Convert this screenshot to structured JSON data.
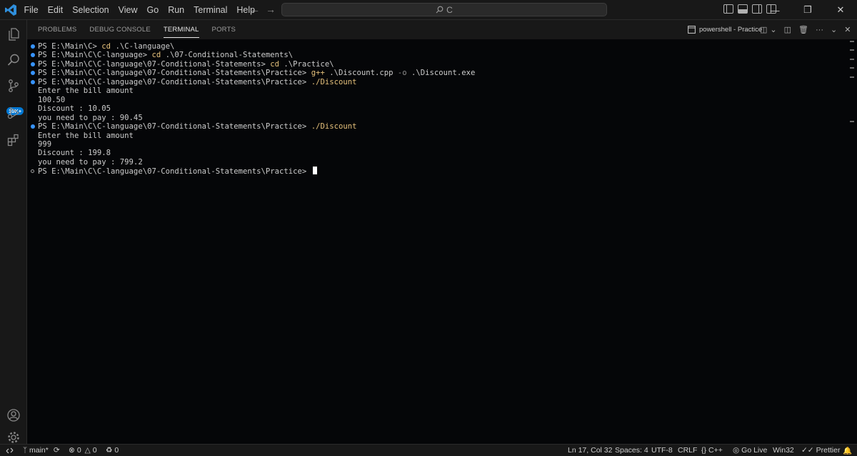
{
  "menu": [
    "File",
    "Edit",
    "Selection",
    "View",
    "Go",
    "Run",
    "Terminal",
    "Help"
  ],
  "search": {
    "text": "C"
  },
  "activity": {
    "badge": "10K+"
  },
  "panel": {
    "tabs": [
      "PROBLEMS",
      "DEBUG CONSOLE",
      "TERMINAL",
      "PORTS"
    ],
    "terminal_title": "powershell - Practice"
  },
  "terminal": {
    "lines": [
      {
        "dot": "blue",
        "prompt": "PS E:\\Main\\C> ",
        "cmd": "cd",
        "args": " .\\C-language\\"
      },
      {
        "dot": "blue",
        "prompt": "PS E:\\Main\\C\\C-language> ",
        "cmd": "cd",
        "args": " .\\07-Conditional-Statements\\"
      },
      {
        "dot": "blue",
        "prompt": "PS E:\\Main\\C\\C-language\\07-Conditional-Statements> ",
        "cmd": "cd",
        "args": " .\\Practice\\"
      },
      {
        "dot": "blue",
        "prompt": "PS E:\\Main\\C\\C-language\\07-Conditional-Statements\\Practice> ",
        "cmd": "g++",
        "args": " .\\Discount.cpp ",
        "flag": "-o",
        "args2": " .\\Discount.exe"
      },
      {
        "dot": "blue",
        "prompt": "PS E:\\Main\\C\\C-language\\07-Conditional-Statements\\Practice> ",
        "cmd": "./Discount"
      },
      {
        "text": "Enter the bill amount"
      },
      {
        "text": "100.50"
      },
      {
        "text": "Discount : 10.05"
      },
      {
        "text": "you need to pay : 90.45"
      },
      {
        "dot": "blue",
        "prompt": "PS E:\\Main\\C\\C-language\\07-Conditional-Statements\\Practice> ",
        "cmd": "./Discount"
      },
      {
        "text": "Enter the bill amount"
      },
      {
        "text": "999"
      },
      {
        "text": "Discount : 199.8"
      },
      {
        "text": "you need to pay : 799.2"
      },
      {
        "dot": "empty",
        "prompt": "PS E:\\Main\\C\\C-language\\07-Conditional-Statements\\Practice> ",
        "cursor": true
      }
    ]
  },
  "status": {
    "branch": "main*",
    "errors": "0",
    "warnings": "0",
    "ports": "0",
    "position": "Ln 17, Col 32",
    "spaces": "Spaces: 4",
    "encoding": "UTF-8",
    "eol": "CRLF",
    "language": "C++",
    "golive": "Go Live",
    "platform": "Win32",
    "prettier": "Prettier"
  },
  "colors": {
    "accent": "#0078d4",
    "terminal_bg": "#050608",
    "command": "#e5c07b",
    "dot": "#3794ff"
  }
}
